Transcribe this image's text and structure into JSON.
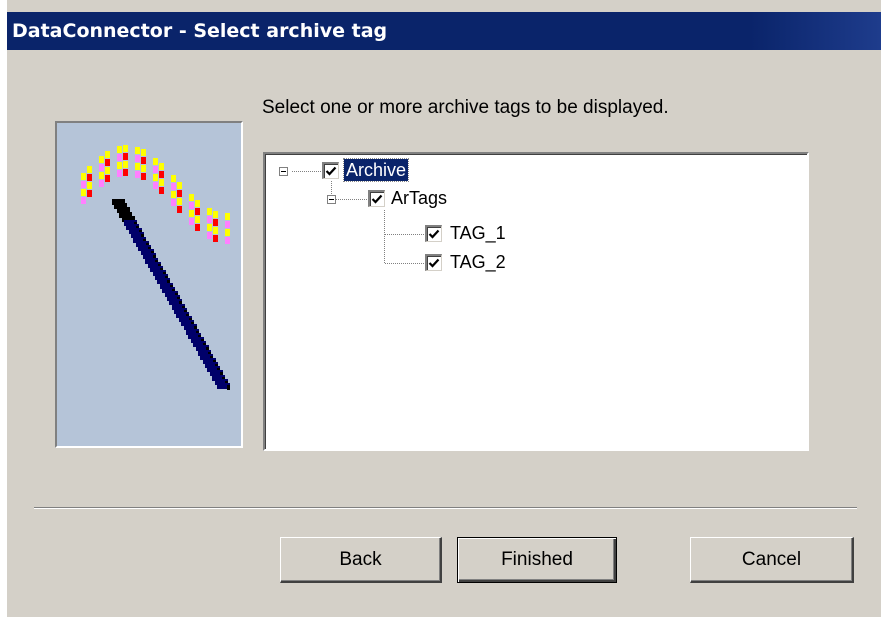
{
  "window": {
    "title": "DataConnector - Select archive tag"
  },
  "wizard": {
    "instruction": "Select one or more archive tags to be displayed."
  },
  "tree": {
    "root": {
      "label": "Archive",
      "checked": true,
      "expanded": true,
      "selected": true
    },
    "group": {
      "label": "ArTags",
      "checked": true,
      "expanded": true
    },
    "tags": [
      {
        "label": "TAG_1",
        "checked": true
      },
      {
        "label": "TAG_2",
        "checked": true
      }
    ]
  },
  "buttons": {
    "back": "Back",
    "finished": "Finished",
    "cancel": "Cancel"
  },
  "colors": {
    "titlebar": "#0a246a",
    "dialog": "#d4d0c8",
    "image_background": "#b5c4d8",
    "selection": "#0a246a"
  },
  "icons": {
    "wizard_image": "trend-wave-wand-icon",
    "check": "checkmark-icon",
    "expander": "minus-box-icon"
  }
}
